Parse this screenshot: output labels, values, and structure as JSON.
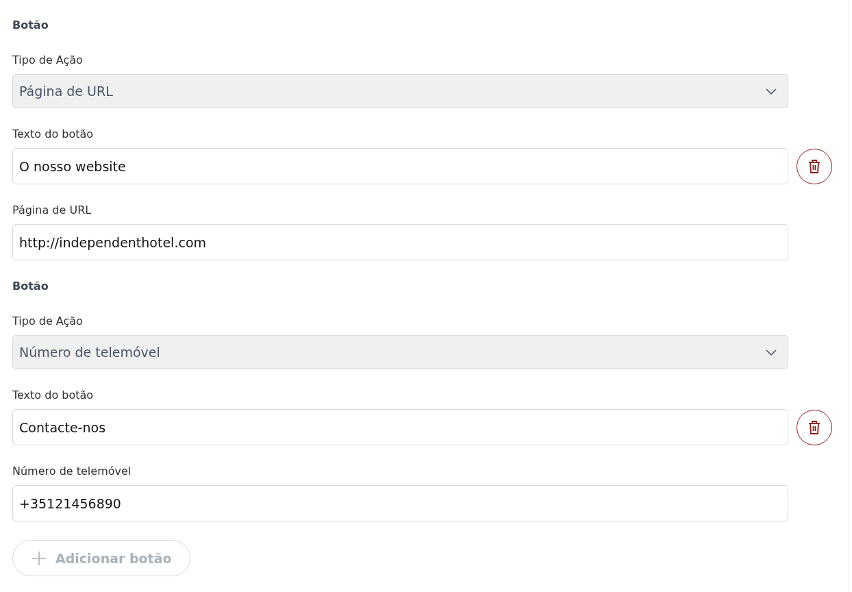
{
  "groups": [
    {
      "heading": "Botão",
      "fields": [
        {
          "kind": "select",
          "label": "Tipo de Ação",
          "value": "Página de URL",
          "removable": false
        },
        {
          "kind": "text",
          "label": "Texto do botão",
          "value": "O nosso website",
          "removable": true
        },
        {
          "kind": "text",
          "label": "Página de URL",
          "value": "http://independenthotel.com",
          "removable": false
        }
      ]
    },
    {
      "heading": "Botão",
      "fields": [
        {
          "kind": "select",
          "label": "Tipo de Ação",
          "value": "Número de telemóvel",
          "removable": false
        },
        {
          "kind": "text",
          "label": "Texto do botão",
          "value": "Contacte-nos",
          "removable": true
        },
        {
          "kind": "text",
          "label": "Número de telemóvel",
          "value": "+35121456890",
          "removable": false
        }
      ]
    }
  ],
  "add_button": {
    "label": "Adicionar botão",
    "disabled": true
  }
}
